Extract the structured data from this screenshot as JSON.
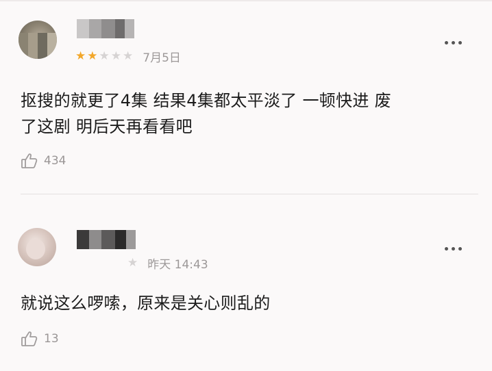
{
  "comments": [
    {
      "rating": {
        "filled": 2,
        "total": 5
      },
      "date": "7月5日",
      "text_line1": "抠搜的就更了4集 结果4集都太平淡了 一顿快进 废",
      "text_line2": "了这剧 明后天再看看吧",
      "likes": "434"
    },
    {
      "rating": {
        "filled": 0,
        "total": 1
      },
      "date": "昨天 14:43",
      "text_line1": "就说这么啰嗦，原来是关心则乱的",
      "likes": "13"
    }
  ],
  "icons": {
    "more": "more-dots-icon",
    "like": "thumbs-up-icon",
    "star": "star-icon"
  },
  "colors": {
    "star_on": "#f2a72a",
    "star_off": "#d6d3d3",
    "meta_text": "#9c9898",
    "background": "#fbf9f9"
  }
}
